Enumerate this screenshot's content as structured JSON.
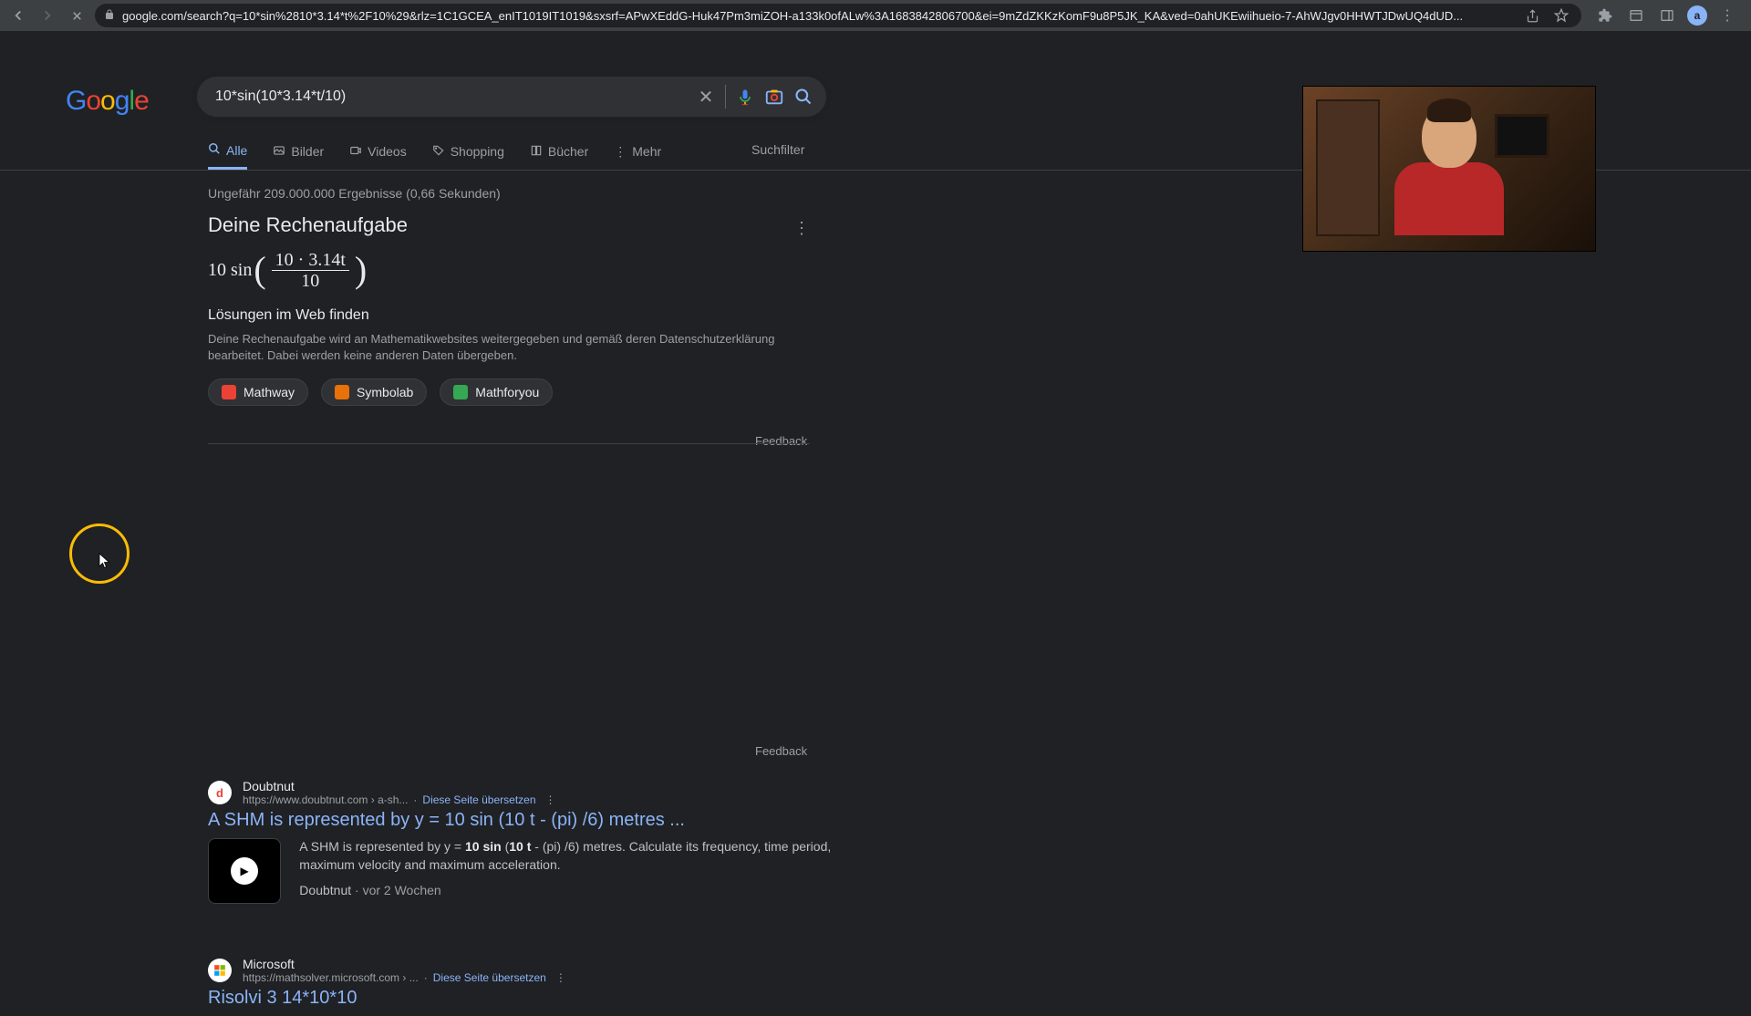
{
  "browser": {
    "url": "google.com/search?q=10*sin%2810*3.14*t%2F10%29&rlz=1C1GCEA_enIT1019IT1019&sxsrf=APwXEddG-Huk47Pm3miZOH-a133k0ofALw%3A1683842806700&ei=9mZdZKKzKomF9u8P5JK_KA&ved=0ahUKEwiihueio-7-AhWJgv0HHWTJDwUQ4dUD...",
    "avatar_initial": "a"
  },
  "search": {
    "query": "10*sin(10*3.14*t/10)"
  },
  "tabs": {
    "all": "Alle",
    "images": "Bilder",
    "videos": "Videos",
    "shopping": "Shopping",
    "books": "Bücher",
    "more": "Mehr",
    "filters": "Suchfilter"
  },
  "stats": "Ungefähr 209.000.000 Ergebnisse (0,66 Sekunden)",
  "mathcard": {
    "title": "Deine Rechenaufgabe",
    "f_pre": "10 sin",
    "f_num": "10 · 3.14t",
    "f_den": "10",
    "solutions_head": "Lösungen im Web finden",
    "solutions_desc": "Deine Rechenaufgabe wird an Mathematikwebsites weitergegeben und gemäß deren Datenschutzerklärung bearbeitet. Dabei werden keine anderen Daten übergeben.",
    "chips": {
      "mathway": "Mathway",
      "symbolab": "Symbolab",
      "mathforyou": "Mathforyou"
    }
  },
  "feedback": "Feedback",
  "results": {
    "r1": {
      "source": "Doubtnut",
      "url": "https://www.doubtnut.com › a-sh...",
      "translate": "Diese Seite übersetzen",
      "title": "A SHM is represented by y = 10 sin (10 t - (pi) /6) metres ...",
      "snippet_pre": "A SHM is represented by y = ",
      "snippet_b1": "10 sin",
      "snippet_mid": " (",
      "snippet_b2": "10 t",
      "snippet_post": " - (pi) /6) metres. Calculate its frequency, time period, maximum velocity and maximum acceleration.",
      "meta_src": "Doubtnut",
      "meta_time": "vor 2 Wochen"
    },
    "r2": {
      "source": "Microsoft",
      "url": "https://mathsolver.microsoft.com › ...",
      "translate": "Diese Seite übersetzen",
      "title": "Risolvi 3 14*10*10"
    }
  }
}
